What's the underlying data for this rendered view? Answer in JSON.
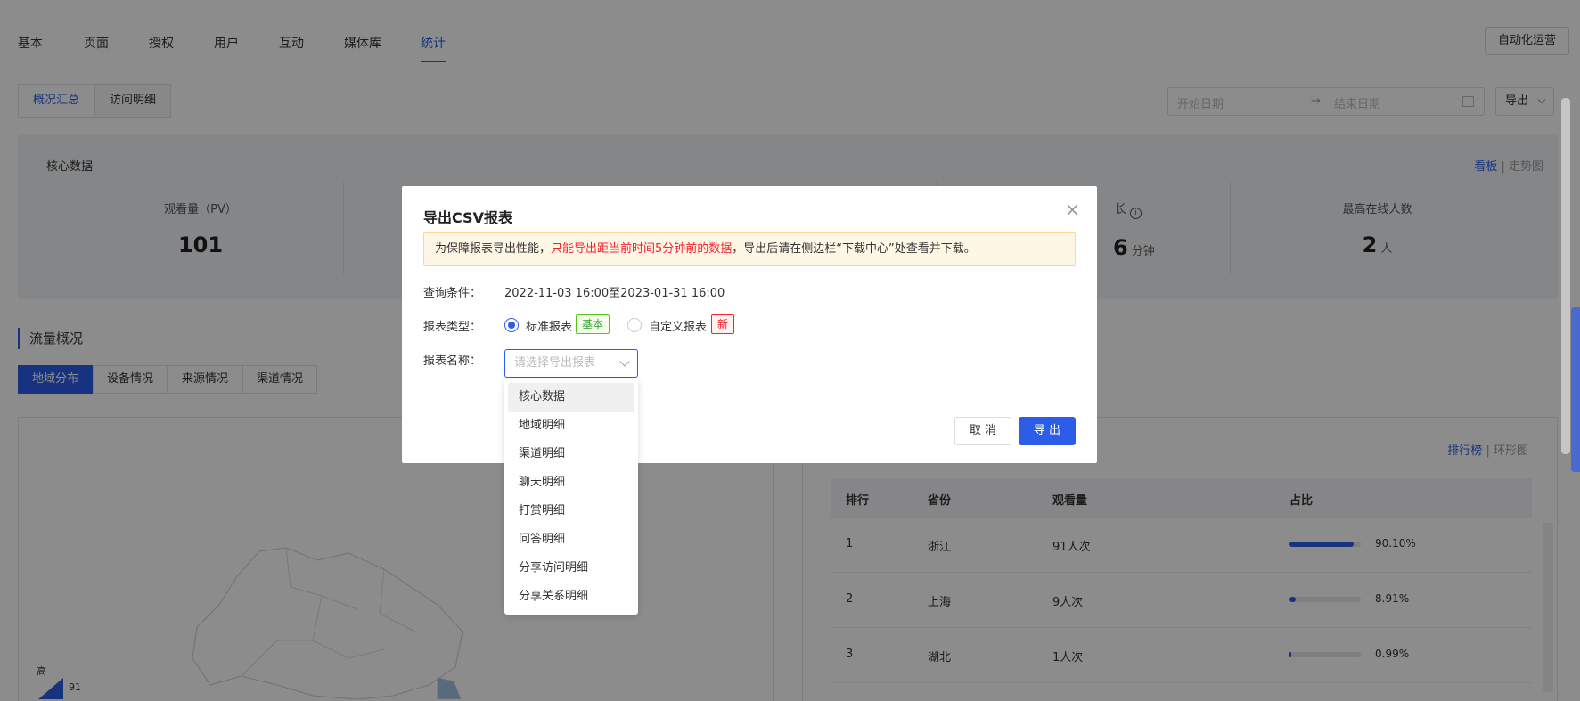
{
  "topnav": {
    "tabs": [
      {
        "label": "基本",
        "active": false
      },
      {
        "label": "页面",
        "active": false
      },
      {
        "label": "授权",
        "active": false
      },
      {
        "label": "用户",
        "active": false
      },
      {
        "label": "互动",
        "active": false
      },
      {
        "label": "媒体库",
        "active": false
      },
      {
        "label": "统计",
        "active": true
      }
    ],
    "auto_ops_label": "自动化运营"
  },
  "subtabs": [
    {
      "label": "概况汇总",
      "active": true
    },
    {
      "label": "访问明细",
      "active": false
    }
  ],
  "date_range": {
    "start_placeholder": "开始日期",
    "arrow": "→",
    "end_placeholder": "结束日期"
  },
  "export_dropdown_label": "导出",
  "core": {
    "title": "核心数据",
    "view_toggle": {
      "board": "看板",
      "separator": "|",
      "trend": "走势图"
    },
    "metrics": [
      {
        "label": "观看量（PV）",
        "value": "101",
        "unit": ""
      },
      {
        "label": "长",
        "value": "6",
        "unit": "分钟"
      },
      {
        "label": "最高在线人数",
        "value": "2",
        "unit": "人"
      }
    ]
  },
  "flow": {
    "title": "流量概况",
    "tabs": [
      {
        "label": "地域分布",
        "active": true
      },
      {
        "label": "设备情况",
        "active": false
      },
      {
        "label": "来源情况",
        "active": false
      },
      {
        "label": "渠道情况",
        "active": false
      }
    ],
    "map_legend": {
      "high_label": "高",
      "max_value": "91"
    }
  },
  "ranking": {
    "view_toggle": {
      "rank": "排行榜",
      "separator": "|",
      "donut": "环形图"
    },
    "columns": [
      "排行",
      "省份",
      "观看量",
      "占比"
    ],
    "rows": [
      {
        "rank": "1",
        "province": "浙江",
        "views": "91人次",
        "percent": "90.10%",
        "ratio": 0.901
      },
      {
        "rank": "2",
        "province": "上海",
        "views": "9人次",
        "percent": "8.91%",
        "ratio": 0.0891
      },
      {
        "rank": "3",
        "province": "湖北",
        "views": "1人次",
        "percent": "0.99%",
        "ratio": 0.0099
      }
    ]
  },
  "modal": {
    "title": "导出CSV报表",
    "notice_prefix": "为保障报表导出性能，",
    "notice_highlight": "只能导出距当前时间5分钟前的数据",
    "notice_suffix": "，导出后请在侧边栏“下载中心”处查看并下载。",
    "query_label": "查询条件：",
    "query_value": "2022-11-03 16:00至2023-01-31 16:00",
    "report_type_label": "报表类型：",
    "report_types": [
      {
        "label": "标准报表",
        "tag": "基本",
        "selected": true
      },
      {
        "label": "自定义报表",
        "tag": "新",
        "selected": false
      }
    ],
    "report_name_label": "报表名称：",
    "report_name_placeholder": "请选择导出报表",
    "cancel_label": "取 消",
    "export_label": "导 出",
    "colors": {
      "primary": "#2b5de8",
      "warning_bg": "#fff7e6",
      "danger": "#f5222d",
      "success": "#52c41a"
    }
  },
  "dropdown_options": [
    "核心数据",
    "地域明细",
    "渠道明细",
    "聊天明细",
    "打赏明细",
    "问答明细",
    "分享访问明细",
    "分享关系明细"
  ]
}
